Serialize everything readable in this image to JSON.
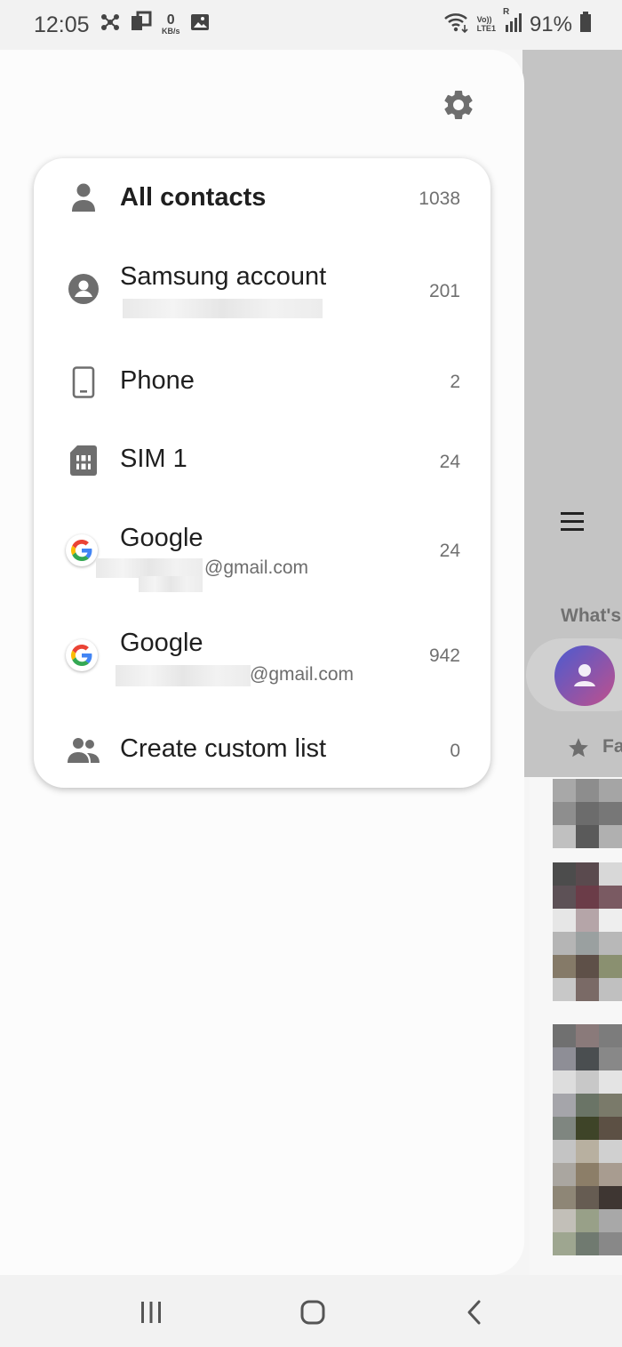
{
  "status_bar": {
    "time": "12:05",
    "speed_value": "0",
    "speed_unit": "KB/s",
    "volte": "Vo))",
    "lte": "LTE1",
    "roaming": "R",
    "battery": "91%"
  },
  "background": {
    "whats_label": "What's",
    "favorites_label": "Fa"
  },
  "accounts": [
    {
      "title": "All contacts",
      "subtitle": "",
      "count": "1038",
      "icon": "person-icon"
    },
    {
      "title": "Samsung account",
      "subtitle": "",
      "count": "201",
      "icon": "account-circle-icon"
    },
    {
      "title": "Phone",
      "subtitle": "",
      "count": "2",
      "icon": "phone-device-icon"
    },
    {
      "title": "SIM 1",
      "subtitle": "",
      "count": "24",
      "icon": "sim-card-icon"
    },
    {
      "title": "Google",
      "subtitle": "@gmail.com",
      "count": "24",
      "icon": "google-icon"
    },
    {
      "title": "Google",
      "subtitle": "@gmail.com",
      "count": "942",
      "icon": "google-icon"
    },
    {
      "title": "Create custom list",
      "subtitle": "",
      "count": "0",
      "icon": "group-icon"
    }
  ],
  "colors": {
    "icon_gray": "#6e6e6e",
    "google_blue": "#4285F4",
    "google_red": "#EA4335",
    "google_yellow": "#FBBC05",
    "google_green": "#34A853"
  }
}
